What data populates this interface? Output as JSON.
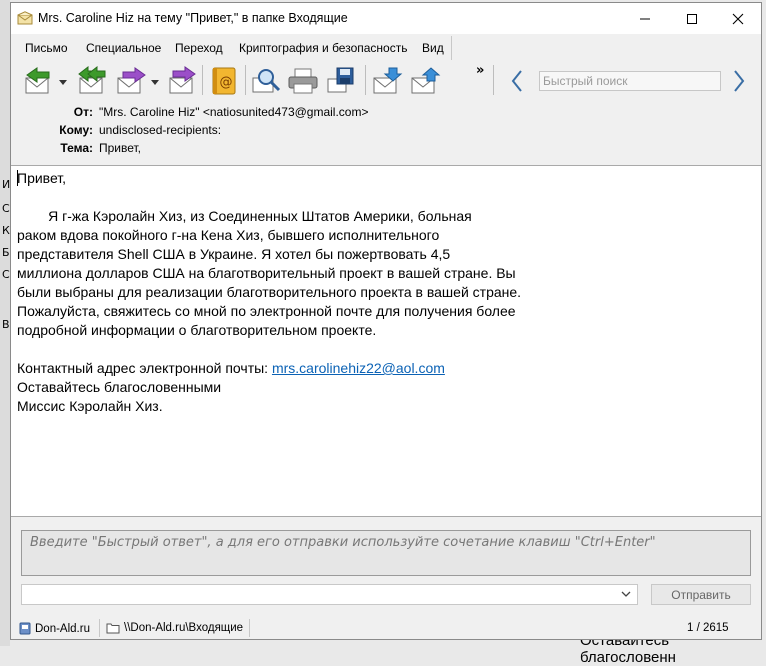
{
  "window": {
    "title": "Mrs. Caroline Hiz на тему \"Привет,\" в папке Входящие",
    "buttons": {
      "minimize": "minimize",
      "maximize": "maximize",
      "close": "close"
    }
  },
  "menu": [
    "Письмо",
    "Специальное",
    "Переход",
    "Криптография и безопасность",
    "Вид"
  ],
  "toolbar": {
    "overflow": "»",
    "search_placeholder": "Быстрый поиск",
    "icons": [
      "back-icon",
      "back-all-icon",
      "forward-icon",
      "move-icon",
      "address-book-icon",
      "find-icon",
      "print-icon",
      "save-icon",
      "download-icon",
      "upload-icon"
    ]
  },
  "headers": {
    "from_label": "От:",
    "from_value": "\"Mrs. Caroline Hiz\" <natiosunited473@gmail.com>",
    "to_label": "Кому:",
    "to_value": "undisclosed-recipients:",
    "subject_label": "Тема:",
    "subject_value": "Привет,"
  },
  "message": {
    "greeting": "Привет,",
    "para": [
      "        Я г-жа Кэролайн Хиз, из Соединенных Штатов Америки, больная",
      "раком вдова покойного г-на Кена Хиз, бывшего исполнительного",
      "представителя Shell США в Украине. Я хотел бы пожертвовать 4,5",
      "миллиона долларов США на благотворительный проект в вашей стране. Вы",
      "были выбраны для реализации благотворительного проекта в вашей стране.",
      "Пожалуйста, свяжитесь со мной по электронной почте для получения более",
      "подробной информации о благотворительном проекте."
    ],
    "contact_label": "Контактный адрес электронной почты: ",
    "contact_email": "mrs.carolinehiz22@aol.com",
    "closing": "Оставайтесь благословенными",
    "signature": "Миссис Кэролайн Хиз."
  },
  "reply": {
    "placeholder": "Введите \"Быстрый ответ\", а для его отправки используйте сочетание клавиш \"Ctrl+Enter\"",
    "send_label": "Отправить"
  },
  "status": {
    "account": "Don-Ald.ru",
    "folder": "\\\\Don-Ald.ru\\Входящие",
    "count": "1 / 2615"
  },
  "background": {
    "letters": [
      "И",
      "С",
      "К",
      "Б",
      "С",
      "В"
    ],
    "bottom_text": "Оставайтесь благословенн"
  },
  "colors": {
    "accent": "#3d9a2b",
    "link": "#0b62b5",
    "window_bg": "#f0f0f0"
  }
}
